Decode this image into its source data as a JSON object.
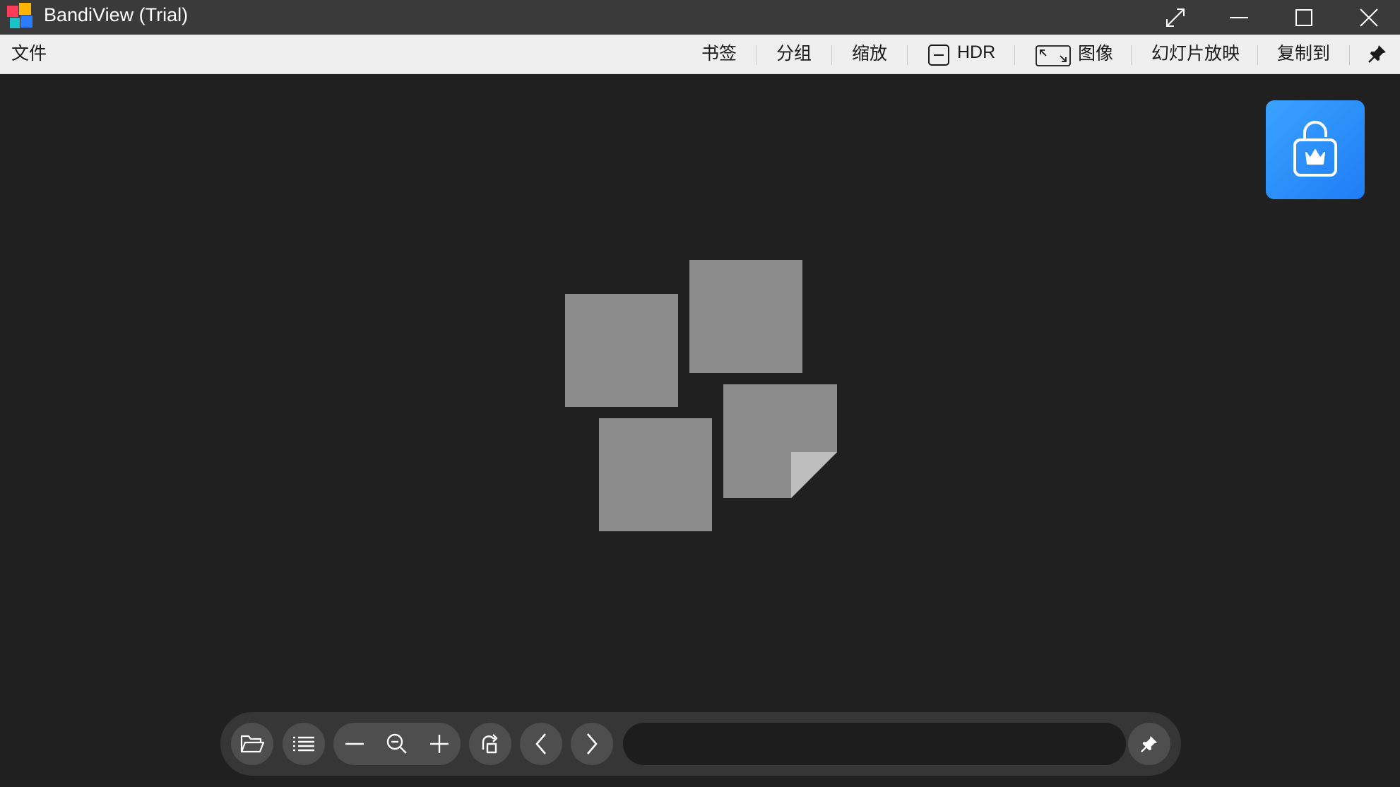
{
  "window": {
    "title": "BandiView (Trial)",
    "icons": {
      "app": "bandiview-logo-icon",
      "fullscreen": "fullscreen-icon",
      "minimize": "minimize-icon",
      "maximize": "maximize-icon",
      "close": "close-icon"
    }
  },
  "menubar": {
    "file": "文件",
    "bookmark": "书签",
    "group": "分组",
    "zoom": "缩放",
    "hdr": "HDR",
    "image": "图像",
    "slideshow": "幻灯片放映",
    "copy_to": "复制到",
    "icons": {
      "hdr": "hdr-toggle-icon",
      "image": "fit-image-icon",
      "pin": "pin-icon"
    }
  },
  "viewer": {
    "store_icon": "store-bag-crown-icon",
    "placeholder_icon": "image-placeholder-icon"
  },
  "toolbar": {
    "path_value": "",
    "icons": [
      "open-folder-icon",
      "list-icon",
      "zoom-out-icon",
      "zoom-fit-icon",
      "zoom-in-icon",
      "rotate-icon",
      "previous-icon",
      "next-icon",
      "pin-icon"
    ]
  },
  "colors": {
    "titlebar": "#3a3a3a",
    "menubar": "#efefef",
    "background": "#202020",
    "toolbar": "#363636",
    "toolbar_button": "#4e4e4e",
    "accent": "#2a8cff",
    "placeholder": "#8c8c8c"
  }
}
